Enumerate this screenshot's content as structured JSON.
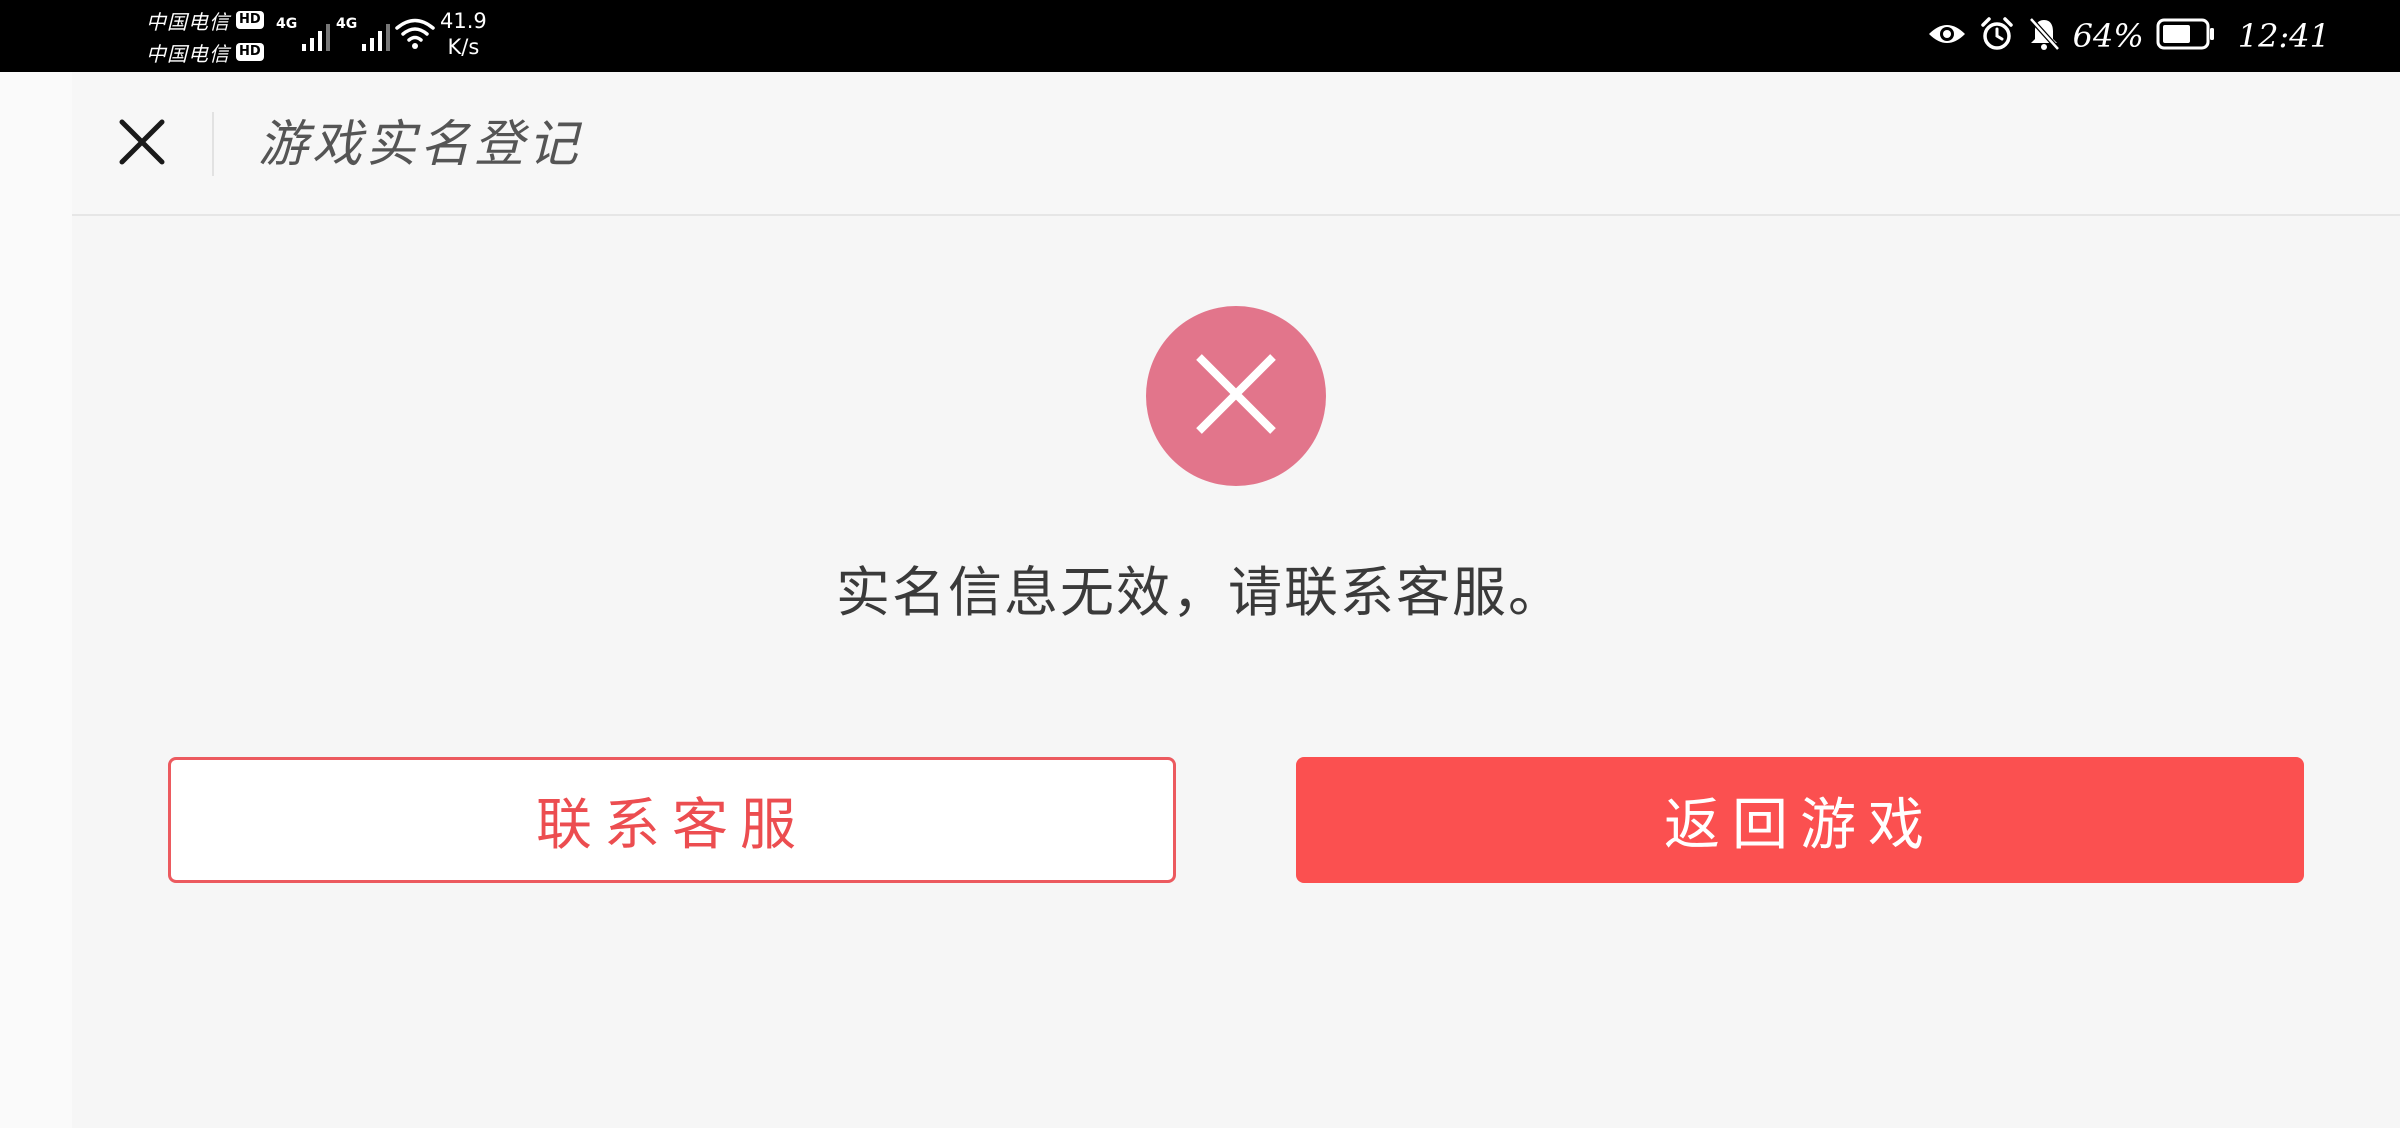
{
  "status_bar": {
    "carrier_1": "中国电信",
    "carrier_2": "中国电信",
    "hd_badge": "HD",
    "network_type": "4G",
    "net_speed_value": "41.9",
    "net_speed_unit": "K/s",
    "battery_percent": "64%",
    "time": "12:41",
    "icons": [
      "eye-icon",
      "alarm-icon",
      "bell-muted-icon",
      "battery-icon",
      "wifi-icon",
      "signal-icon"
    ]
  },
  "header": {
    "title": "游戏实名登记",
    "close_icon": "close-icon"
  },
  "main": {
    "error_icon": "error-x-icon",
    "error_color": "#e2758b",
    "message": "实名信息无效，请联系客服。"
  },
  "buttons": {
    "contact_label": "联系客服",
    "return_label": "返回游戏",
    "accent_color": "#fb5050"
  }
}
